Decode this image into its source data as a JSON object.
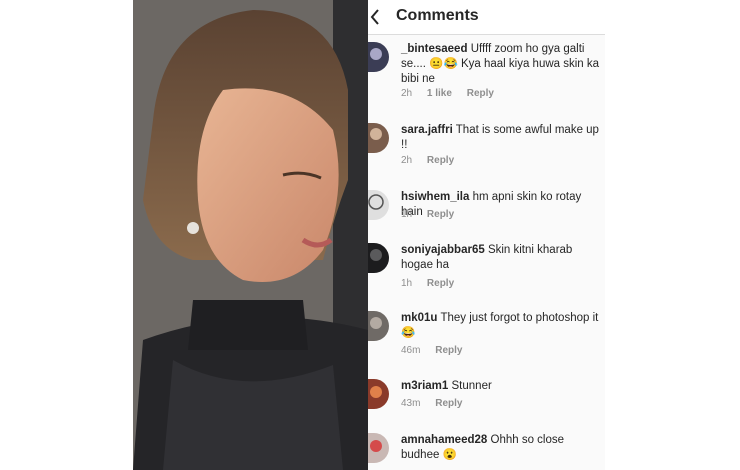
{
  "header": {
    "title": "Comments"
  },
  "comments": [
    {
      "username": "_bintesaeed",
      "text": "Uffff zoom ho gya galti se.... 😐😂 Kya haal kiya huwa skin ka bibi ne",
      "time": "2h",
      "likes": "1 like",
      "reply": "Reply"
    },
    {
      "username": "sara.jaffri",
      "text": "That is some awful make up !!",
      "time": "2h",
      "likes": "",
      "reply": "Reply"
    },
    {
      "username": "hsiwhem_ila",
      "text": "hm apni skin ko rotay hain",
      "time": "1h",
      "likes": "",
      "reply": "Reply"
    },
    {
      "username": "soniyajabbar65",
      "text": "Skin kitni kharab hogae ha",
      "time": "1h",
      "likes": "",
      "reply": "Reply"
    },
    {
      "username": "mk01u",
      "text": "They just forgot to photoshop it 😂",
      "time": "46m",
      "likes": "",
      "reply": "Reply"
    },
    {
      "username": "m3riam1",
      "text": "Stunner",
      "time": "43m",
      "likes": "",
      "reply": "Reply"
    },
    {
      "username": "amnahameed28",
      "text": "Ohhh so close budhee 😮",
      "time": "",
      "likes": "",
      "reply": ""
    }
  ],
  "colors": {
    "text": "#262626",
    "muted": "#8e8e8e",
    "emoji": "#f7c51e"
  },
  "icons": {
    "back": "back-arrow-icon"
  }
}
